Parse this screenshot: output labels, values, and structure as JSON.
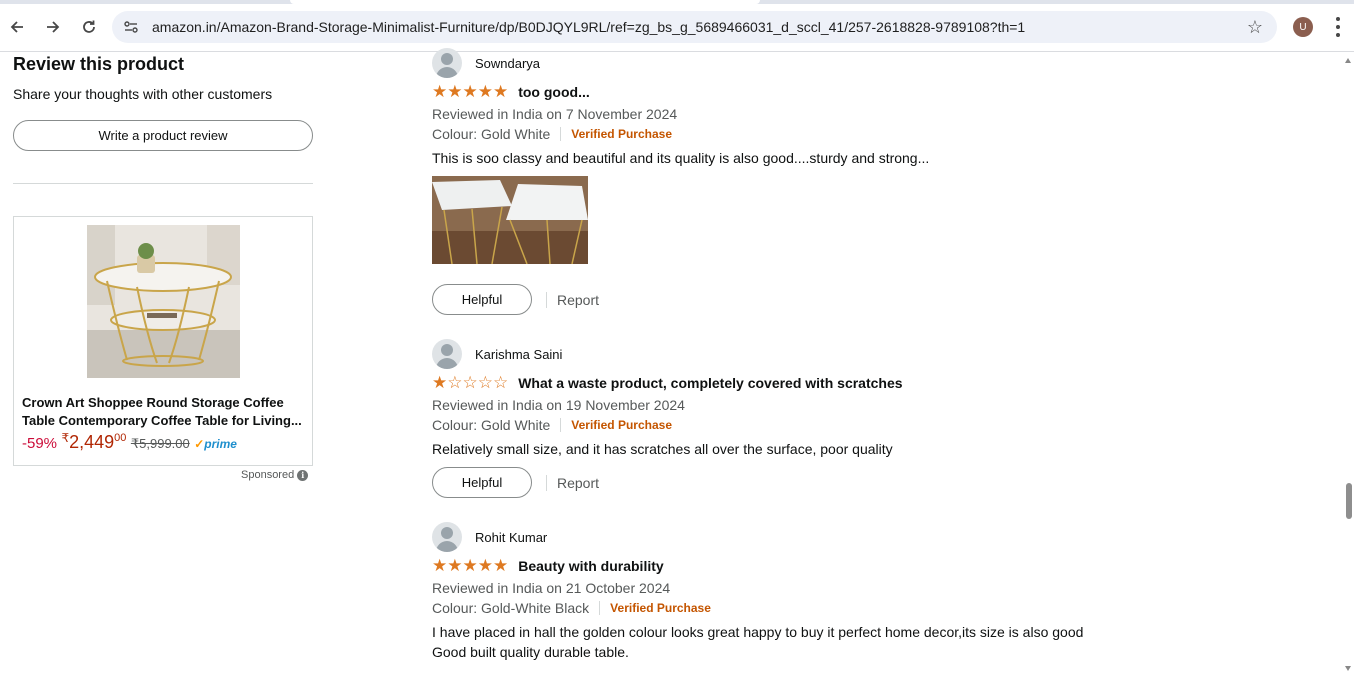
{
  "browser": {
    "url": "amazon.in/Amazon-Brand-Storage-Minimalist-Furniture/dp/B0DJQYL9RL/ref=zg_bs_g_5689466031_d_sccl_41/257-2618828-9789108?th=1",
    "profile_initial": "U"
  },
  "sidebar": {
    "heading": "Review this product",
    "subheading": "Share your thoughts with other customers",
    "write_review_label": "Write a product review",
    "ad": {
      "title": "Crown Art Shoppee Round Storage Coffee Table Contemporary Coffee Table for Living...",
      "discount": "-59%",
      "currency": "₹",
      "price_whole": "2,449",
      "price_fraction": "00",
      "mrp": "₹5,999.00",
      "prime_label": "prime",
      "sponsored_label": "Sponsored"
    }
  },
  "reviews": [
    {
      "reviewer": "Sowndarya",
      "rating": 5,
      "stars_text": "★★★★★",
      "title": "too good...",
      "date_line": "Reviewed in India on 7 November 2024",
      "colour": "Colour: Gold White",
      "verified": "Verified Purchase",
      "body": "This is soo classy and beautiful and its quality is also good....sturdy and strong...",
      "has_photo": true,
      "helpful_label": "Helpful",
      "report_label": "Report"
    },
    {
      "reviewer": "Karishma Saini",
      "rating": 1,
      "stars_text": "★☆☆☆☆",
      "title": "What a waste product, completely covered with scratches",
      "date_line": "Reviewed in India on 19 November 2024",
      "colour": "Colour: Gold White",
      "verified": "Verified Purchase",
      "body": "Relatively small size, and it has scratches all over the surface, poor quality",
      "has_photo": false,
      "helpful_label": "Helpful",
      "report_label": "Report"
    },
    {
      "reviewer": "Rohit Kumar",
      "rating": 5,
      "stars_text": "★★★★★",
      "title": "Beauty with durability",
      "date_line": "Reviewed in India on 21 October 2024",
      "colour": "Colour: Gold-White Black",
      "verified": "Verified Purchase",
      "body_line1": "I have placed in hall the golden colour looks great happy to buy it perfect home decor,its size is also good",
      "body_line2": "Good built quality durable table."
    }
  ],
  "colors": {
    "star": "#de7921",
    "verified": "#c45500",
    "price": "#b12704",
    "discount": "#cc0c39",
    "prime": "#1f8fcd"
  }
}
